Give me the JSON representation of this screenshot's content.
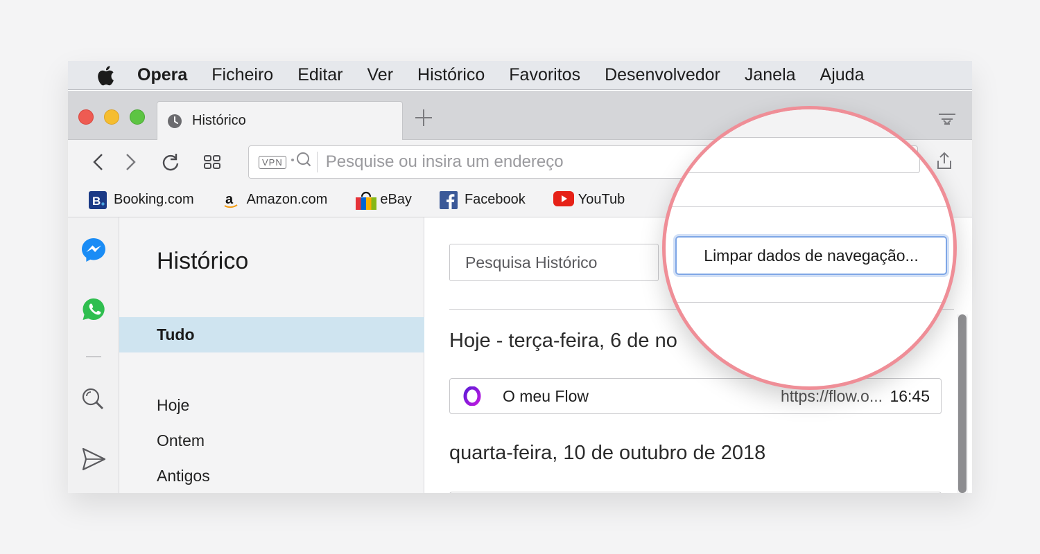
{
  "menubar": {
    "items": [
      "Opera",
      "Ficheiro",
      "Editar",
      "Ver",
      "Histórico",
      "Favoritos",
      "Desenvolvedor",
      "Janela",
      "Ajuda"
    ]
  },
  "tab": {
    "title": "Histórico"
  },
  "toolbar": {
    "vpn_label": "VPN",
    "address_placeholder": "Pesquise ou insira um endereço"
  },
  "bookmarks": [
    {
      "label": "Booking.com",
      "icon": "booking-icon",
      "color": "#1b3a86"
    },
    {
      "label": "Amazon.com",
      "icon": "amazon-icon",
      "color": "#111111"
    },
    {
      "label": "eBay",
      "icon": "ebay-icon",
      "color": "#e53238"
    },
    {
      "label": "Facebook",
      "icon": "facebook-icon",
      "color": "#3b5998"
    },
    {
      "label": "YouTub",
      "icon": "youtube-icon",
      "color": "#e62117"
    }
  ],
  "history": {
    "title": "Histórico",
    "nav": {
      "all": "Tudo",
      "today": "Hoje",
      "yesterday": "Ontem",
      "older": "Antigos"
    },
    "search_placeholder": "Pesquisa Histórico",
    "clear_button": "Limpar dados de navegação...",
    "groups": [
      {
        "heading": "Hoje - terça-feira, 6 de no",
        "entries": [
          {
            "title": "O meu Flow",
            "url": "https://flow.o...",
            "time": "16:45"
          }
        ]
      },
      {
        "heading": "quarta-feira, 10 de outubro de 2018",
        "entries": []
      }
    ]
  },
  "colors": {
    "accent": "#ef8e97",
    "selection": "#cfe4f0",
    "focus": "#7ea6e6"
  }
}
